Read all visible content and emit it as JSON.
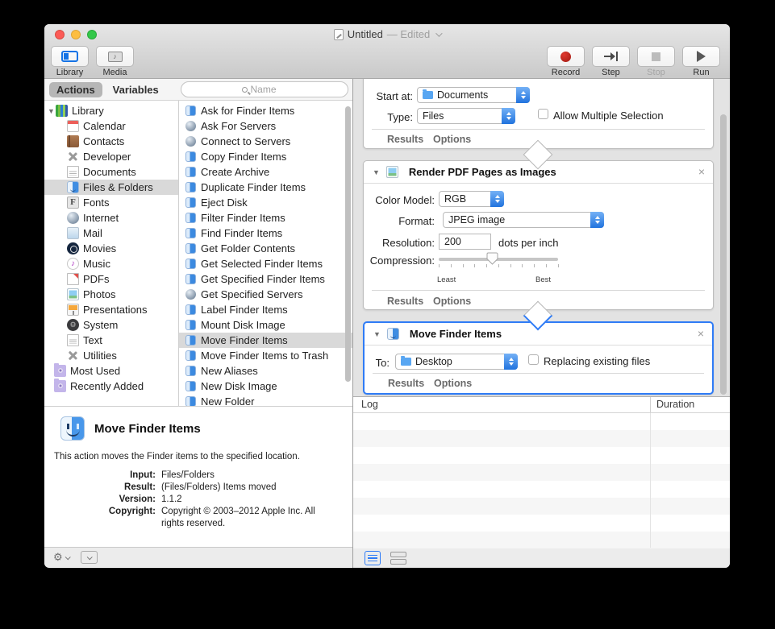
{
  "window": {
    "title": "Untitled",
    "edited": "— Edited"
  },
  "toolbar": {
    "library": "Library",
    "media": "Media",
    "record": "Record",
    "step": "Step",
    "stop": "Stop",
    "run": "Run"
  },
  "filterbar": {
    "actions_tab": "Actions",
    "variables_tab": "Variables",
    "search_placeholder": "Name"
  },
  "library": {
    "selected": "Files & Folders",
    "items": [
      "Library",
      "Calendar",
      "Contacts",
      "Developer",
      "Documents",
      "Files & Folders",
      "Fonts",
      "Internet",
      "Mail",
      "Movies",
      "Music",
      "PDFs",
      "Photos",
      "Presentations",
      "System",
      "Text",
      "Utilities",
      "Most Used",
      "Recently Added"
    ]
  },
  "actions": {
    "selected": "Move Finder Items",
    "items": [
      "Ask for Finder Items",
      "Ask For Servers",
      "Connect to Servers",
      "Copy Finder Items",
      "Create Archive",
      "Duplicate Finder Items",
      "Eject Disk",
      "Filter Finder Items",
      "Find Finder Items",
      "Get Folder Contents",
      "Get Selected Finder Items",
      "Get Specified Finder Items",
      "Get Specified Servers",
      "Label Finder Items",
      "Mount Disk Image",
      "Move Finder Items",
      "Move Finder Items to Trash",
      "New Aliases",
      "New Disk Image",
      "New Folder"
    ]
  },
  "workflow": {
    "ask_card": {
      "start_at_label": "Start at:",
      "start_at_value": "Documents",
      "type_label": "Type:",
      "type_value": "Files",
      "multiple_selection_label": "Allow Multiple Selection",
      "results_label": "Results",
      "options_label": "Options"
    },
    "render_card": {
      "title": "Render PDF Pages as Images",
      "close_label": "×",
      "color_model_label": "Color Model:",
      "color_model_value": "RGB",
      "format_label": "Format:",
      "format_value": "JPEG image",
      "resolution_label": "Resolution:",
      "resolution_value": "200",
      "resolution_unit": "dots per inch",
      "compression_label": "Compression:",
      "compression_min_label": "Least",
      "compression_max_label": "Best",
      "compression_percent": 45,
      "results_label": "Results",
      "options_label": "Options"
    },
    "move_card": {
      "title": "Move Finder Items",
      "close_label": "×",
      "to_label": "To:",
      "to_value": "Desktop",
      "replace_label": "Replacing existing files",
      "results_label": "Results",
      "options_label": "Options"
    }
  },
  "log": {
    "log_column": "Log",
    "duration_column": "Duration"
  },
  "description": {
    "title": "Move Finder Items",
    "summary": "This action moves the Finder items to the specified location.",
    "input_label": "Input:",
    "input_value": "Files/Folders",
    "result_label": "Result:",
    "result_value": "(Files/Folders) Items moved",
    "version_label": "Version:",
    "version_value": "1.1.2",
    "copyright_label": "Copyright:",
    "copyright_value": "Copyright © 2003–2012 Apple Inc.  All rights reserved."
  },
  "colors": {
    "accent_blue": "#2f7cf6",
    "popup_blue": "#2173de",
    "record_red": "#c22a24",
    "selection_gray": "#d9d9d9"
  }
}
